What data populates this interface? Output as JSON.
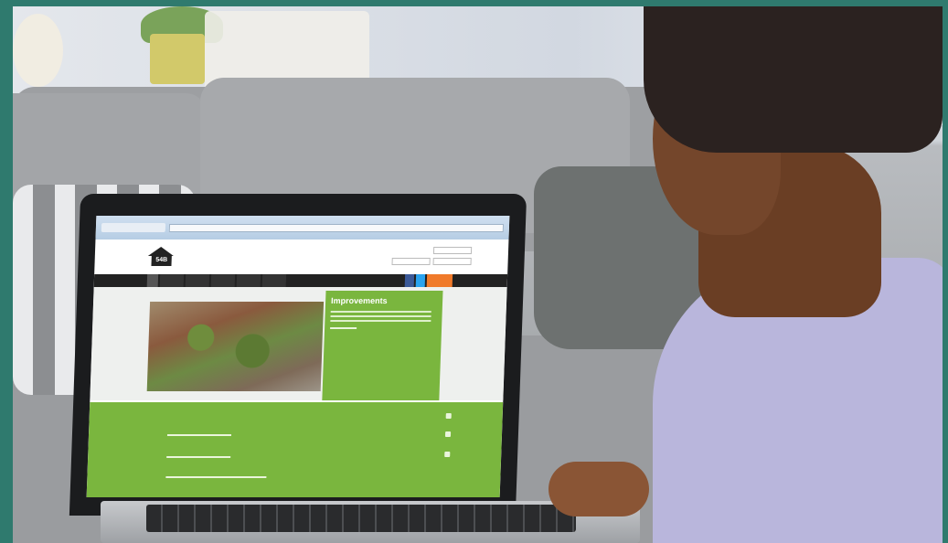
{
  "scene": {
    "background_border_color": "#2f7a6e",
    "subject": "woman-using-laptop",
    "setting": "living-room-sofa"
  },
  "website": {
    "logo_text": "54B",
    "hero_title": "Improvements",
    "colors": {
      "brand_green": "#7ab63e",
      "nav_dark": "#222222",
      "facebook": "#3b5998",
      "twitter": "#2aa3ef",
      "orange_button": "#f07a2a"
    },
    "icons": [
      "facebook-icon",
      "twitter-icon",
      "home-icon"
    ]
  }
}
